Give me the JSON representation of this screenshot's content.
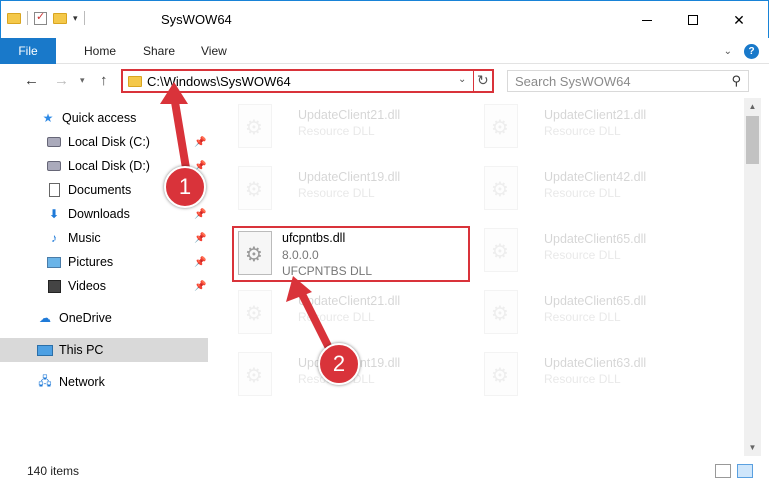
{
  "window": {
    "title": "SysWOW64",
    "minimize_label": "",
    "maximize_label": "",
    "close_label": "✕"
  },
  "ribbon": {
    "tabs": [
      {
        "label": "File"
      },
      {
        "label": "Home"
      },
      {
        "label": "Share"
      },
      {
        "label": "View"
      }
    ]
  },
  "navigation": {
    "back": "←",
    "forward": "→",
    "recent": "▾",
    "up": "↑",
    "address": "C:\\Windows\\SysWOW64",
    "refresh": "↻",
    "search_placeholder": "Search SysWOW64"
  },
  "sidebar": {
    "items": [
      {
        "label": "Quick access",
        "icon": "star-icon",
        "pinned": false
      },
      {
        "label": "Local Disk (C:)",
        "icon": "disk-icon",
        "pinned": true
      },
      {
        "label": "Local Disk (D:)",
        "icon": "disk-icon",
        "pinned": true
      },
      {
        "label": "Documents",
        "icon": "document-icon",
        "pinned": true
      },
      {
        "label": "Downloads",
        "icon": "download-icon",
        "pinned": true
      },
      {
        "label": "Music",
        "icon": "music-icon",
        "pinned": true
      },
      {
        "label": "Pictures",
        "icon": "pictures-icon",
        "pinned": true
      },
      {
        "label": "Videos",
        "icon": "videos-icon",
        "pinned": true
      },
      {
        "label": "OneDrive",
        "icon": "cloud-icon",
        "pinned": false
      },
      {
        "label": "This PC",
        "icon": "computer-icon",
        "pinned": false,
        "selected": true
      },
      {
        "label": "Network",
        "icon": "network-icon",
        "pinned": false
      }
    ]
  },
  "files": [
    {
      "name": "UpdateClient21.dll",
      "line2": "Resource DLL",
      "line3": "",
      "faded": true
    },
    {
      "name": "UpdateClient21.dll",
      "line2": "Resource DLL",
      "line3": "",
      "faded": true
    },
    {
      "name": "UpdateClient19.dll",
      "line2": "Resource DLL",
      "line3": "",
      "faded": true
    },
    {
      "name": "UpdateClient42.dll",
      "line2": "Resource DLL",
      "line3": "",
      "faded": true
    },
    {
      "name": "ufcpntbs.dll",
      "line2": "8.0.0.0",
      "line3": "UFCPNTBS DLL",
      "faded": false,
      "highlighted": true
    },
    {
      "name": "UpdateClient65.dll",
      "line2": "Resource DLL",
      "line3": "",
      "faded": true
    },
    {
      "name": "UpdateClient21.dll",
      "line2": "Resource DLL",
      "line3": "",
      "faded": true
    },
    {
      "name": "UpdateClient65.dll",
      "line2": "Resource DLL",
      "line3": "",
      "faded": true
    },
    {
      "name": "UpdateClient19.dll",
      "line2": "Resource DLL",
      "line3": "",
      "faded": true
    },
    {
      "name": "UpdateClient63.dll",
      "line2": "Resource DLL",
      "line3": "",
      "faded": true
    }
  ],
  "status": {
    "item_count": "140 items"
  },
  "annotations": {
    "step1": "1",
    "step2": "2",
    "color": "#d9333a"
  }
}
